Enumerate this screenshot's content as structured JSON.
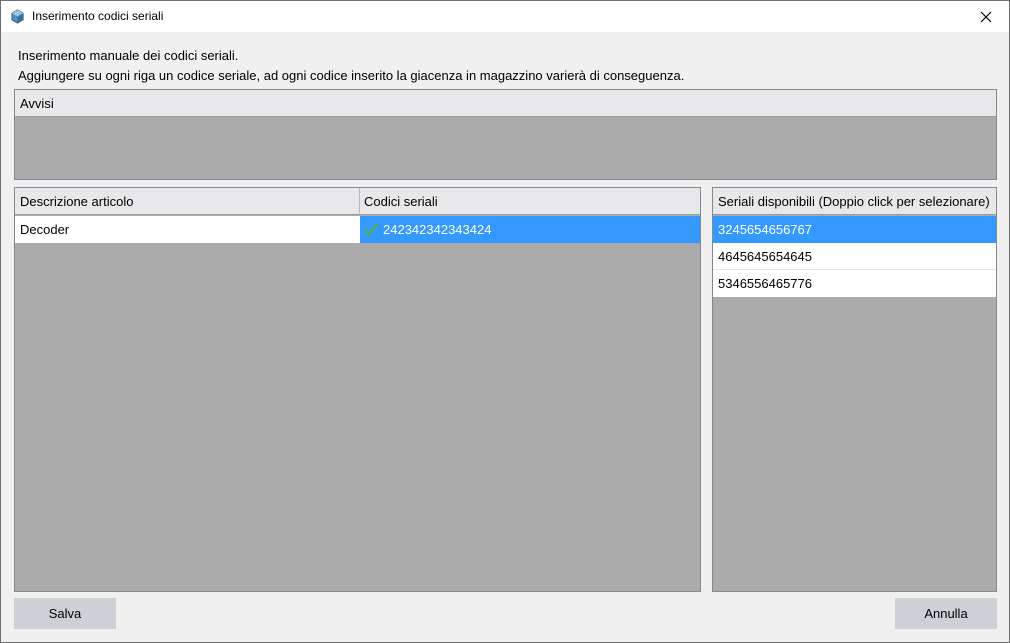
{
  "window": {
    "title": "Inserimento codici seriali"
  },
  "info": {
    "line1": "Inserimento manuale dei codici seriali.",
    "line2": "Aggiungere su ogni riga un codice seriale, ad ogni codice inserito la giacenza in magazzino varierà di conseguenza."
  },
  "avvisi": {
    "header": "Avvisi"
  },
  "items_table": {
    "columns": [
      "Descrizione articolo",
      "Codici seriali"
    ],
    "rows": [
      {
        "description": "Decoder",
        "serial": "242342342343424",
        "status_icon": "check-icon"
      }
    ]
  },
  "available_serials": {
    "header": "Seriali disponibili (Doppio click per selezionare)",
    "items": [
      "3245654656767",
      "4645645654645",
      "5346556465776"
    ],
    "selected_index": 0
  },
  "buttons": {
    "save": "Salva",
    "cancel": "Annulla"
  },
  "colors": {
    "selection": "#3399ff",
    "panel_bg": "#ababab",
    "check": "#4caf50"
  }
}
